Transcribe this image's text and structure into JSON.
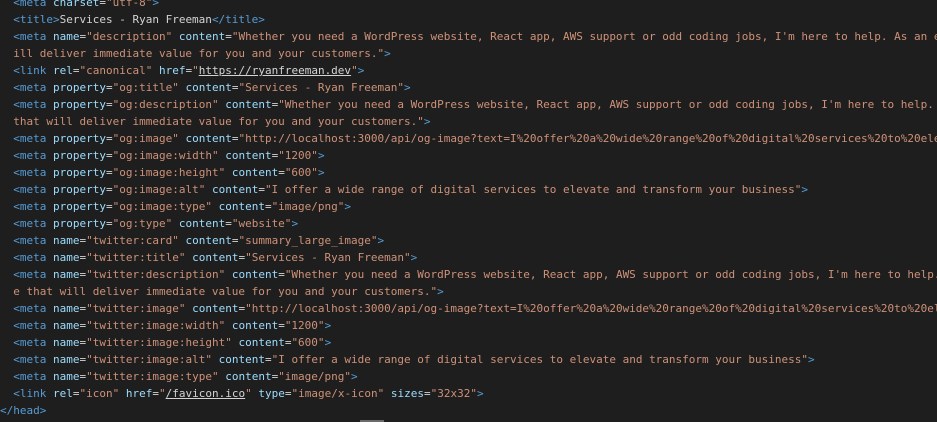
{
  "colors": {
    "background": "#1e1e1e",
    "tag": "#569cd6",
    "attribute": "#9cdcfe",
    "string": "#ce9178",
    "text": "#d4d4d4",
    "punctuation": "#808080"
  },
  "lines": [
    {
      "indent": "  ",
      "tokens": [
        {
          "t": "<meta ",
          "c": "tag"
        },
        {
          "t": "charset",
          "c": "attr"
        },
        {
          "t": "=",
          "c": "text"
        },
        {
          "t": "\"utf-8\"",
          "c": "str"
        },
        {
          "t": ">",
          "c": "tag"
        }
      ]
    },
    {
      "indent": "  ",
      "tokens": [
        {
          "t": "<title>",
          "c": "tag"
        },
        {
          "t": "Services - Ryan Freeman",
          "c": "text"
        },
        {
          "t": "</title>",
          "c": "tag"
        }
      ]
    },
    {
      "indent": "  ",
      "tokens": [
        {
          "t": "<meta ",
          "c": "tag"
        },
        {
          "t": "name",
          "c": "attr"
        },
        {
          "t": "=",
          "c": "text"
        },
        {
          "t": "\"description\"",
          "c": "str"
        },
        {
          "t": " ",
          "c": "text"
        },
        {
          "t": "content",
          "c": "attr"
        },
        {
          "t": "=",
          "c": "text"
        },
        {
          "t": "\"Whether you need a WordPress website, React app, AWS support or odd coding jobs, I'm here to help. As an e",
          "c": "str"
        }
      ]
    },
    {
      "indent": "  ",
      "tokens": [
        {
          "t": "ill deliver immediate value for you and your customers.\"",
          "c": "str"
        },
        {
          "t": ">",
          "c": "tag"
        }
      ]
    },
    {
      "indent": "  ",
      "tokens": [
        {
          "t": "<link ",
          "c": "tag"
        },
        {
          "t": "rel",
          "c": "attr"
        },
        {
          "t": "=",
          "c": "text"
        },
        {
          "t": "\"canonical\"",
          "c": "str"
        },
        {
          "t": " ",
          "c": "text"
        },
        {
          "t": "href",
          "c": "attr"
        },
        {
          "t": "=",
          "c": "text"
        },
        {
          "t": "\"",
          "c": "str"
        },
        {
          "t": "https://ryanfreeman.dev",
          "c": "link"
        },
        {
          "t": "\"",
          "c": "str"
        },
        {
          "t": ">",
          "c": "tag"
        }
      ]
    },
    {
      "indent": "  ",
      "tokens": [
        {
          "t": "<meta ",
          "c": "tag"
        },
        {
          "t": "property",
          "c": "attr"
        },
        {
          "t": "=",
          "c": "text"
        },
        {
          "t": "\"og:title\"",
          "c": "str"
        },
        {
          "t": " ",
          "c": "text"
        },
        {
          "t": "content",
          "c": "attr"
        },
        {
          "t": "=",
          "c": "text"
        },
        {
          "t": "\"Services - Ryan Freeman\"",
          "c": "str"
        },
        {
          "t": ">",
          "c": "tag"
        }
      ]
    },
    {
      "indent": "  ",
      "tokens": [
        {
          "t": "<meta ",
          "c": "tag"
        },
        {
          "t": "property",
          "c": "attr"
        },
        {
          "t": "=",
          "c": "text"
        },
        {
          "t": "\"og:description\"",
          "c": "str"
        },
        {
          "t": " ",
          "c": "text"
        },
        {
          "t": "content",
          "c": "attr"
        },
        {
          "t": "=",
          "c": "text"
        },
        {
          "t": "\"Whether you need a WordPress website, React app, AWS support or odd coding jobs, I'm here to help.",
          "c": "str"
        }
      ]
    },
    {
      "indent": "  ",
      "tokens": [
        {
          "t": "that will deliver immediate value for you and your customers.\"",
          "c": "str"
        },
        {
          "t": ">",
          "c": "tag"
        }
      ]
    },
    {
      "indent": "  ",
      "tokens": [
        {
          "t": "<meta ",
          "c": "tag"
        },
        {
          "t": "property",
          "c": "attr"
        },
        {
          "t": "=",
          "c": "text"
        },
        {
          "t": "\"og:image\"",
          "c": "str"
        },
        {
          "t": " ",
          "c": "text"
        },
        {
          "t": "content",
          "c": "attr"
        },
        {
          "t": "=",
          "c": "text"
        },
        {
          "t": "\"http://localhost:3000/api/og-image?text=I%20offer%20a%20wide%20range%20of%20digital%20services%20to%20ele",
          "c": "str"
        }
      ]
    },
    {
      "indent": "  ",
      "tokens": [
        {
          "t": "<meta ",
          "c": "tag"
        },
        {
          "t": "property",
          "c": "attr"
        },
        {
          "t": "=",
          "c": "text"
        },
        {
          "t": "\"og:image:width\"",
          "c": "str"
        },
        {
          "t": " ",
          "c": "text"
        },
        {
          "t": "content",
          "c": "attr"
        },
        {
          "t": "=",
          "c": "text"
        },
        {
          "t": "\"1200\"",
          "c": "str"
        },
        {
          "t": ">",
          "c": "tag"
        }
      ]
    },
    {
      "indent": "  ",
      "tokens": [
        {
          "t": "<meta ",
          "c": "tag"
        },
        {
          "t": "property",
          "c": "attr"
        },
        {
          "t": "=",
          "c": "text"
        },
        {
          "t": "\"og:image:height\"",
          "c": "str"
        },
        {
          "t": " ",
          "c": "text"
        },
        {
          "t": "content",
          "c": "attr"
        },
        {
          "t": "=",
          "c": "text"
        },
        {
          "t": "\"600\"",
          "c": "str"
        },
        {
          "t": ">",
          "c": "tag"
        }
      ]
    },
    {
      "indent": "  ",
      "tokens": [
        {
          "t": "<meta ",
          "c": "tag"
        },
        {
          "t": "property",
          "c": "attr"
        },
        {
          "t": "=",
          "c": "text"
        },
        {
          "t": "\"og:image:alt\"",
          "c": "str"
        },
        {
          "t": " ",
          "c": "text"
        },
        {
          "t": "content",
          "c": "attr"
        },
        {
          "t": "=",
          "c": "text"
        },
        {
          "t": "\"I offer a wide range of digital services to elevate and transform your business\"",
          "c": "str"
        },
        {
          "t": ">",
          "c": "tag"
        }
      ]
    },
    {
      "indent": "  ",
      "tokens": [
        {
          "t": "<meta ",
          "c": "tag"
        },
        {
          "t": "property",
          "c": "attr"
        },
        {
          "t": "=",
          "c": "text"
        },
        {
          "t": "\"og:image:type\"",
          "c": "str"
        },
        {
          "t": " ",
          "c": "text"
        },
        {
          "t": "content",
          "c": "attr"
        },
        {
          "t": "=",
          "c": "text"
        },
        {
          "t": "\"image/png\"",
          "c": "str"
        },
        {
          "t": ">",
          "c": "tag"
        }
      ]
    },
    {
      "indent": "  ",
      "tokens": [
        {
          "t": "<meta ",
          "c": "tag"
        },
        {
          "t": "property",
          "c": "attr"
        },
        {
          "t": "=",
          "c": "text"
        },
        {
          "t": "\"og:type\"",
          "c": "str"
        },
        {
          "t": " ",
          "c": "text"
        },
        {
          "t": "content",
          "c": "attr"
        },
        {
          "t": "=",
          "c": "text"
        },
        {
          "t": "\"website\"",
          "c": "str"
        },
        {
          "t": ">",
          "c": "tag"
        }
      ]
    },
    {
      "indent": "  ",
      "tokens": [
        {
          "t": "<meta ",
          "c": "tag"
        },
        {
          "t": "name",
          "c": "attr"
        },
        {
          "t": "=",
          "c": "text"
        },
        {
          "t": "\"twitter:card\"",
          "c": "str"
        },
        {
          "t": " ",
          "c": "text"
        },
        {
          "t": "content",
          "c": "attr"
        },
        {
          "t": "=",
          "c": "text"
        },
        {
          "t": "\"summary_large_image\"",
          "c": "str"
        },
        {
          "t": ">",
          "c": "tag"
        }
      ]
    },
    {
      "indent": "  ",
      "tokens": [
        {
          "t": "<meta ",
          "c": "tag"
        },
        {
          "t": "name",
          "c": "attr"
        },
        {
          "t": "=",
          "c": "text"
        },
        {
          "t": "\"twitter:title\"",
          "c": "str"
        },
        {
          "t": " ",
          "c": "text"
        },
        {
          "t": "content",
          "c": "attr"
        },
        {
          "t": "=",
          "c": "text"
        },
        {
          "t": "\"Services - Ryan Freeman\"",
          "c": "str"
        },
        {
          "t": ">",
          "c": "tag"
        }
      ]
    },
    {
      "indent": "  ",
      "tokens": [
        {
          "t": "<meta ",
          "c": "tag"
        },
        {
          "t": "name",
          "c": "attr"
        },
        {
          "t": "=",
          "c": "text"
        },
        {
          "t": "\"twitter:description\"",
          "c": "str"
        },
        {
          "t": " ",
          "c": "text"
        },
        {
          "t": "content",
          "c": "attr"
        },
        {
          "t": "=",
          "c": "text"
        },
        {
          "t": "\"Whether you need a WordPress website, React app, AWS support or odd coding jobs, I'm here to help.",
          "c": "str"
        }
      ]
    },
    {
      "indent": "  ",
      "tokens": [
        {
          "t": "e that will deliver immediate value for you and your customers.\"",
          "c": "str"
        },
        {
          "t": ">",
          "c": "tag"
        }
      ]
    },
    {
      "indent": "  ",
      "tokens": [
        {
          "t": "<meta ",
          "c": "tag"
        },
        {
          "t": "name",
          "c": "attr"
        },
        {
          "t": "=",
          "c": "text"
        },
        {
          "t": "\"twitter:image\"",
          "c": "str"
        },
        {
          "t": " ",
          "c": "text"
        },
        {
          "t": "content",
          "c": "attr"
        },
        {
          "t": "=",
          "c": "text"
        },
        {
          "t": "\"http://localhost:3000/api/og-image?text=I%20offer%20a%20wide%20range%20of%20digital%20services%20to%20el",
          "c": "str"
        }
      ]
    },
    {
      "indent": "  ",
      "tokens": [
        {
          "t": "<meta ",
          "c": "tag"
        },
        {
          "t": "name",
          "c": "attr"
        },
        {
          "t": "=",
          "c": "text"
        },
        {
          "t": "\"twitter:image:width\"",
          "c": "str"
        },
        {
          "t": " ",
          "c": "text"
        },
        {
          "t": "content",
          "c": "attr"
        },
        {
          "t": "=",
          "c": "text"
        },
        {
          "t": "\"1200\"",
          "c": "str"
        },
        {
          "t": ">",
          "c": "tag"
        }
      ]
    },
    {
      "indent": "  ",
      "tokens": [
        {
          "t": "<meta ",
          "c": "tag"
        },
        {
          "t": "name",
          "c": "attr"
        },
        {
          "t": "=",
          "c": "text"
        },
        {
          "t": "\"twitter:image:height\"",
          "c": "str"
        },
        {
          "t": " ",
          "c": "text"
        },
        {
          "t": "content",
          "c": "attr"
        },
        {
          "t": "=",
          "c": "text"
        },
        {
          "t": "\"600\"",
          "c": "str"
        },
        {
          "t": ">",
          "c": "tag"
        }
      ]
    },
    {
      "indent": "  ",
      "tokens": [
        {
          "t": "<meta ",
          "c": "tag"
        },
        {
          "t": "name",
          "c": "attr"
        },
        {
          "t": "=",
          "c": "text"
        },
        {
          "t": "\"twitter:image:alt\"",
          "c": "str"
        },
        {
          "t": " ",
          "c": "text"
        },
        {
          "t": "content",
          "c": "attr"
        },
        {
          "t": "=",
          "c": "text"
        },
        {
          "t": "\"I offer a wide range of digital services to elevate and transform your business\"",
          "c": "str"
        },
        {
          "t": ">",
          "c": "tag"
        }
      ]
    },
    {
      "indent": "  ",
      "tokens": [
        {
          "t": "<meta ",
          "c": "tag"
        },
        {
          "t": "name",
          "c": "attr"
        },
        {
          "t": "=",
          "c": "text"
        },
        {
          "t": "\"twitter:image:type\"",
          "c": "str"
        },
        {
          "t": " ",
          "c": "text"
        },
        {
          "t": "content",
          "c": "attr"
        },
        {
          "t": "=",
          "c": "text"
        },
        {
          "t": "\"image/png\"",
          "c": "str"
        },
        {
          "t": ">",
          "c": "tag"
        }
      ]
    },
    {
      "indent": "  ",
      "tokens": [
        {
          "t": "<link ",
          "c": "tag"
        },
        {
          "t": "rel",
          "c": "attr"
        },
        {
          "t": "=",
          "c": "text"
        },
        {
          "t": "\"icon\"",
          "c": "str"
        },
        {
          "t": " ",
          "c": "text"
        },
        {
          "t": "href",
          "c": "attr"
        },
        {
          "t": "=",
          "c": "text"
        },
        {
          "t": "\"",
          "c": "str"
        },
        {
          "t": "/favicon.ico",
          "c": "link"
        },
        {
          "t": "\"",
          "c": "str"
        },
        {
          "t": " ",
          "c": "text"
        },
        {
          "t": "type",
          "c": "attr"
        },
        {
          "t": "=",
          "c": "text"
        },
        {
          "t": "\"image/x-icon\"",
          "c": "str"
        },
        {
          "t": " ",
          "c": "text"
        },
        {
          "t": "sizes",
          "c": "attr"
        },
        {
          "t": "=",
          "c": "text"
        },
        {
          "t": "\"32x32\"",
          "c": "str"
        },
        {
          "t": ">",
          "c": "tag"
        }
      ]
    },
    {
      "indent": "",
      "tokens": [
        {
          "t": "</head>",
          "c": "tag"
        }
      ]
    }
  ]
}
